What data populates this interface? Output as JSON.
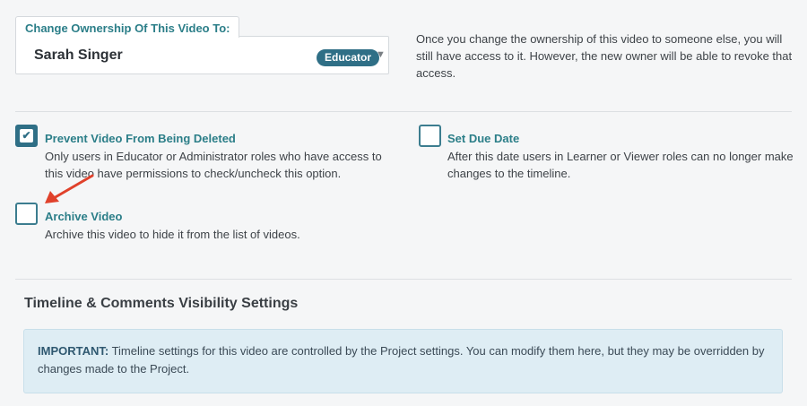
{
  "ownership": {
    "legend": "Change Ownership Of This Video To:",
    "owner_name": "Sarah Singer",
    "role_badge": "Educator",
    "note": "Once you change the ownership of this video to someone else, you will still have access to it. However, the new owner will be able to revoke that access."
  },
  "options": {
    "prevent_delete": {
      "checked": true,
      "title": "Prevent Video From Being Deleted",
      "description": "Only users in Educator or Administrator roles who have access to this video have permissions to check/uncheck this option."
    },
    "due_date": {
      "checked": false,
      "title": "Set Due Date",
      "description": "After this date users in Learner or Viewer roles can no longer make changes to the timeline."
    },
    "archive": {
      "checked": false,
      "title": "Archive Video",
      "description": "Archive this video to hide it from the list of videos."
    }
  },
  "timeline_section": {
    "title": "Timeline & Comments Visibility Settings",
    "notice_label": "IMPORTANT:",
    "notice_text": " Timeline settings for this video are controlled by the Project settings. You can modify them here, but they may be overridden by changes made to the Project."
  },
  "colors": {
    "accent": "#2b7e88",
    "badge": "#2f6f86",
    "notice_bg": "#deedf4",
    "annotation_arrow": "#e0412b"
  }
}
